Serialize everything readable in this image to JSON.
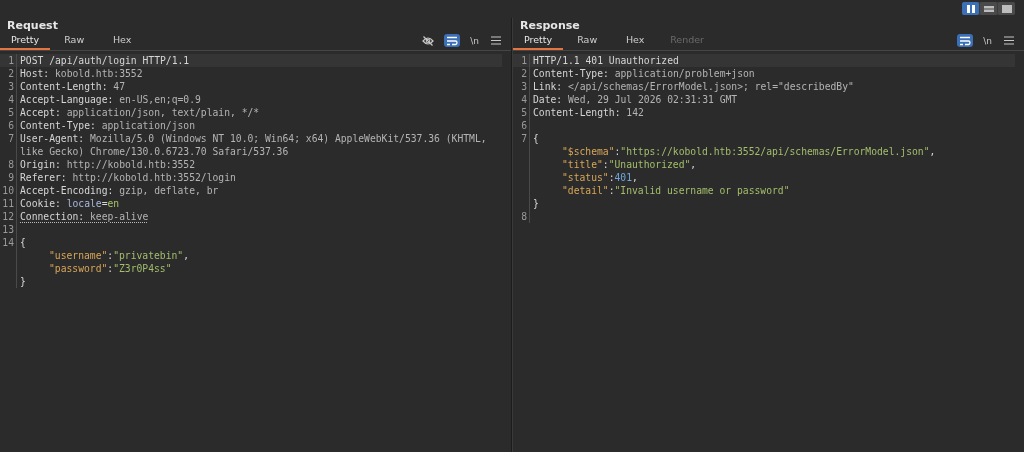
{
  "layout_buttons": [
    {
      "kind": "columns",
      "selected": true
    },
    {
      "kind": "rows",
      "selected": false
    },
    {
      "kind": "single",
      "selected": false
    }
  ],
  "panels": [
    {
      "title": "Request",
      "tabs": [
        {
          "label": "Pretty",
          "selected": true,
          "disabled": false
        },
        {
          "label": "Raw",
          "selected": false,
          "disabled": false
        },
        {
          "label": "Hex",
          "selected": false,
          "disabled": false
        }
      ],
      "toolbar": [
        {
          "kind": "eye-off",
          "selected": false
        },
        {
          "kind": "wrap",
          "selected": true
        },
        {
          "kind": "newline",
          "label": "\\n",
          "selected": false
        },
        {
          "kind": "menu",
          "selected": false
        }
      ],
      "lines": [
        {
          "number": "1",
          "highlighted": true,
          "tokens": [
            {
              "kind": "name",
              "text": "POST /api/auth/login HTTP/1.1"
            }
          ]
        },
        {
          "number": "2",
          "tokens": [
            {
              "kind": "name",
              "text": "Host"
            },
            {
              "kind": "punct",
              "text": ": "
            },
            {
              "kind": "value",
              "text": "kobold.htb:3552"
            }
          ]
        },
        {
          "number": "3",
          "tokens": [
            {
              "kind": "name",
              "text": "Content-Length"
            },
            {
              "kind": "punct",
              "text": ": "
            },
            {
              "kind": "value",
              "text": "47"
            }
          ]
        },
        {
          "number": "4",
          "tokens": [
            {
              "kind": "name",
              "text": "Accept-Language"
            },
            {
              "kind": "punct",
              "text": ": "
            },
            {
              "kind": "value",
              "text": "en-US,en;q=0.9"
            }
          ]
        },
        {
          "number": "5",
          "tokens": [
            {
              "kind": "name",
              "text": "Accept"
            },
            {
              "kind": "punct",
              "text": ": "
            },
            {
              "kind": "value",
              "text": "application/json, text/plain, */*"
            }
          ]
        },
        {
          "number": "6",
          "tokens": [
            {
              "kind": "name",
              "text": "Content-Type"
            },
            {
              "kind": "punct",
              "text": ": "
            },
            {
              "kind": "value",
              "text": "application/json"
            }
          ]
        },
        {
          "number": "7",
          "tokens": [
            {
              "kind": "name",
              "text": "User-Agent"
            },
            {
              "kind": "punct",
              "text": ": "
            },
            {
              "kind": "value",
              "text": "Mozilla/5.0 (Windows NT 10.0; Win64; x64) AppleWebKit/537.36 (KHTML,"
            }
          ]
        },
        {
          "tokens": [
            {
              "kind": "value",
              "text": "like Gecko) Chrome/130.0.6723.70 Safari/537.36"
            }
          ]
        },
        {
          "number": "8",
          "tokens": [
            {
              "kind": "name",
              "text": "Origin"
            },
            {
              "kind": "punct",
              "text": ": "
            },
            {
              "kind": "value",
              "text": "http://kobold.htb:3552"
            }
          ]
        },
        {
          "number": "9",
          "tokens": [
            {
              "kind": "name",
              "text": "Referer"
            },
            {
              "kind": "punct",
              "text": ": "
            },
            {
              "kind": "value",
              "text": "http://kobold.htb:3552/login"
            }
          ]
        },
        {
          "number": "10",
          "tokens": [
            {
              "kind": "name",
              "text": "Accept-Encoding"
            },
            {
              "kind": "punct",
              "text": ": "
            },
            {
              "kind": "value",
              "text": "gzip, deflate, br"
            }
          ]
        },
        {
          "number": "11",
          "tokens": [
            {
              "kind": "name",
              "text": "Cookie"
            },
            {
              "kind": "punct",
              "text": ": "
            },
            {
              "kind": "cookie-name",
              "text": "locale"
            },
            {
              "kind": "punct",
              "text": "="
            },
            {
              "kind": "cookie-value",
              "text": "en"
            }
          ]
        },
        {
          "number": "12",
          "dotted": true,
          "tokens": [
            {
              "kind": "name",
              "text": "Connection"
            },
            {
              "kind": "punct",
              "text": ": "
            },
            {
              "kind": "value",
              "text": "keep-alive"
            }
          ]
        },
        {
          "number": "13"
        },
        {
          "number": "14",
          "tokens": [
            {
              "kind": "punct",
              "text": "{"
            }
          ]
        },
        {
          "indent": true,
          "tokens": [
            {
              "kind": "json-key",
              "text": "\"username\""
            },
            {
              "kind": "punct",
              "text": ":"
            },
            {
              "kind": "json-string",
              "text": "\"privatebin\""
            },
            {
              "kind": "punct",
              "text": ","
            }
          ]
        },
        {
          "indent": true,
          "tokens": [
            {
              "kind": "json-key",
              "text": "\"password\""
            },
            {
              "kind": "punct",
              "text": ":"
            },
            {
              "kind": "json-string",
              "text": "\"Z3r0P4ss\""
            }
          ]
        },
        {
          "tokens": [
            {
              "kind": "punct",
              "text": "}"
            }
          ]
        }
      ]
    },
    {
      "title": "Response",
      "tabs": [
        {
          "label": "Pretty",
          "selected": true,
          "disabled": false
        },
        {
          "label": "Raw",
          "selected": false,
          "disabled": false
        },
        {
          "label": "Hex",
          "selected": false,
          "disabled": false
        },
        {
          "label": "Render",
          "selected": false,
          "disabled": true
        }
      ],
      "toolbar": [
        {
          "kind": "wrap",
          "selected": true
        },
        {
          "kind": "newline",
          "label": "\\n",
          "selected": false
        },
        {
          "kind": "menu",
          "selected": false
        }
      ],
      "lines": [
        {
          "number": "1",
          "highlighted": true,
          "tokens": [
            {
              "kind": "name",
              "text": "HTTP/1.1 401 Unauthorized"
            }
          ]
        },
        {
          "number": "2",
          "tokens": [
            {
              "kind": "name",
              "text": "Content-Type"
            },
            {
              "kind": "punct",
              "text": ": "
            },
            {
              "kind": "value",
              "text": "application/problem+json"
            }
          ]
        },
        {
          "number": "3",
          "tokens": [
            {
              "kind": "name",
              "text": "Link"
            },
            {
              "kind": "punct",
              "text": ": "
            },
            {
              "kind": "value",
              "text": "</api/schemas/ErrorModel.json>; rel=\"describedBy\""
            }
          ]
        },
        {
          "number": "4",
          "tokens": [
            {
              "kind": "name",
              "text": "Date"
            },
            {
              "kind": "punct",
              "text": ": "
            },
            {
              "kind": "value",
              "text": "Wed, 29 Jul 2026 02:31:31 GMT"
            }
          ]
        },
        {
          "number": "5",
          "tokens": [
            {
              "kind": "name",
              "text": "Content-Length"
            },
            {
              "kind": "punct",
              "text": ": "
            },
            {
              "kind": "value",
              "text": "142"
            }
          ]
        },
        {
          "number": "6"
        },
        {
          "number": "7",
          "tokens": [
            {
              "kind": "punct",
              "text": "{"
            }
          ]
        },
        {
          "indent": true,
          "tokens": [
            {
              "kind": "json-key",
              "text": "\"$schema\""
            },
            {
              "kind": "punct",
              "text": ":"
            },
            {
              "kind": "json-string",
              "text": "\"https://kobold.htb:3552/api/schemas/ErrorModel.json\""
            },
            {
              "kind": "punct",
              "text": ","
            }
          ]
        },
        {
          "indent": true,
          "tokens": [
            {
              "kind": "json-key",
              "text": "\"title\""
            },
            {
              "kind": "punct",
              "text": ":"
            },
            {
              "kind": "json-string",
              "text": "\"Unauthorized\""
            },
            {
              "kind": "punct",
              "text": ","
            }
          ]
        },
        {
          "indent": true,
          "tokens": [
            {
              "kind": "json-key",
              "text": "\"status\""
            },
            {
              "kind": "punct",
              "text": ":"
            },
            {
              "kind": "json-number",
              "text": "401"
            },
            {
              "kind": "punct",
              "text": ","
            }
          ]
        },
        {
          "indent": true,
          "tokens": [
            {
              "kind": "json-key",
              "text": "\"detail\""
            },
            {
              "kind": "punct",
              "text": ":"
            },
            {
              "kind": "json-string",
              "text": "\"Invalid username or password\""
            }
          ]
        },
        {
          "tokens": [
            {
              "kind": "punct",
              "text": "}"
            }
          ]
        },
        {
          "number": "8"
        }
      ]
    }
  ]
}
